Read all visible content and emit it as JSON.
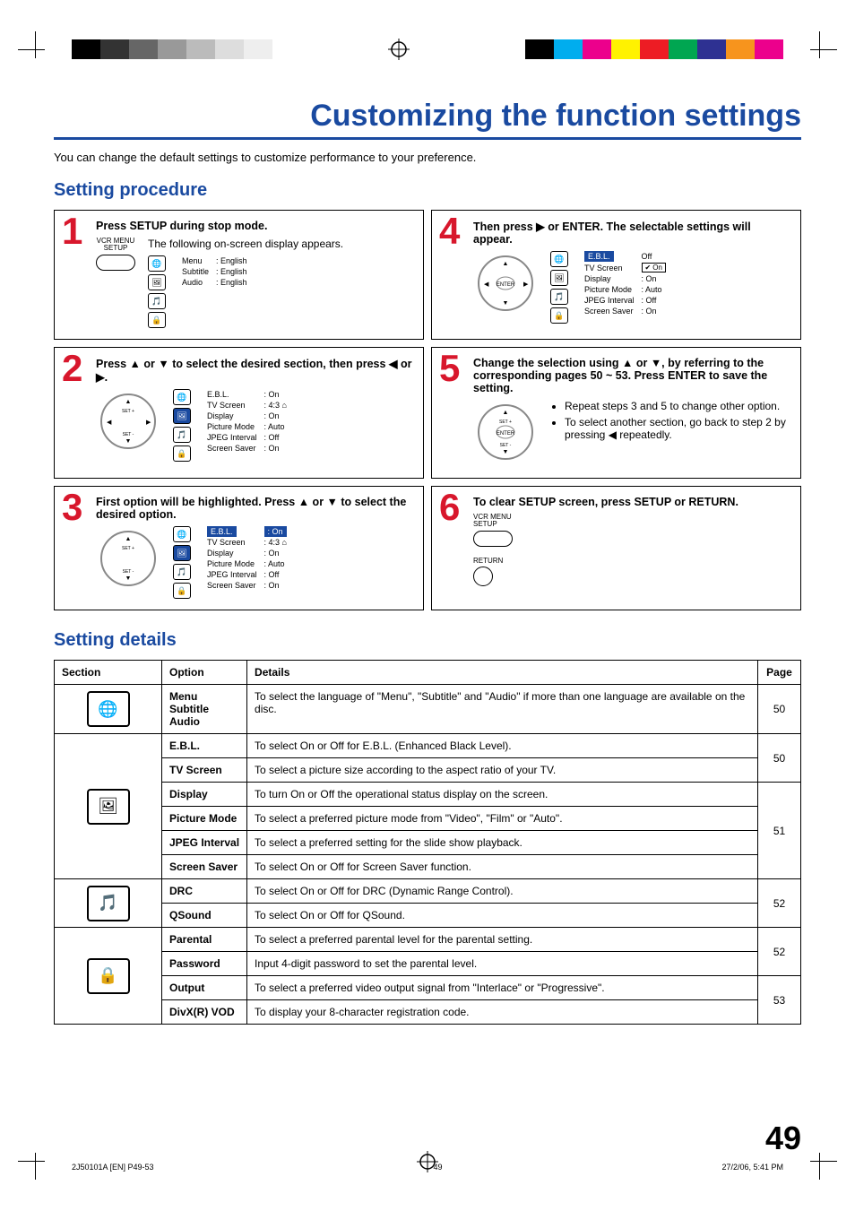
{
  "title": "Customizing the function settings",
  "intro": "You can change the default settings to customize performance to your preference.",
  "headings": {
    "procedure": "Setting procedure",
    "details": "Setting details"
  },
  "steps": {
    "s1": {
      "num": "1",
      "instr": "Press SETUP during stop mode.",
      "btnLabel": "VCR MENU\nSETUP",
      "sub": "The following on-screen display appears.",
      "osd": [
        [
          "Menu",
          ": English"
        ],
        [
          "Subtitle",
          ": English"
        ],
        [
          "Audio",
          ": English"
        ]
      ]
    },
    "s2": {
      "num": "2",
      "instr": "Press ▲ or ▼ to select the desired section, then press ◀ or ▶.",
      "osd": [
        [
          "E.B.L.",
          ": On"
        ],
        [
          "TV Screen",
          ": 4:3 ⌂"
        ],
        [
          "Display",
          ": On"
        ],
        [
          "Picture Mode",
          ": Auto"
        ],
        [
          "JPEG Interval",
          ": Off"
        ],
        [
          "Screen Saver",
          ": On"
        ]
      ]
    },
    "s3": {
      "num": "3",
      "instr": "First option will be highlighted. Press ▲ or ▼ to select the desired option.",
      "osdHighlightLabel": "E.B.L.",
      "osdHighlightValue": ": On",
      "osd": [
        [
          "TV Screen",
          ": 4:3 ⌂"
        ],
        [
          "Display",
          ": On"
        ],
        [
          "Picture Mode",
          ": Auto"
        ],
        [
          "JPEG Interval",
          ": Off"
        ],
        [
          "Screen Saver",
          ": On"
        ]
      ]
    },
    "s4": {
      "num": "4",
      "instr": "Then press ▶ or ENTER. The selectable settings will appear.",
      "osdHighlightLabel": "E.B.L.",
      "osdValueOff": "Off",
      "osdValueOn": "On",
      "osd": [
        [
          "TV Screen",
          ""
        ],
        [
          "Display",
          ": On"
        ],
        [
          "Picture Mode",
          ": Auto"
        ],
        [
          "JPEG Interval",
          ": Off"
        ],
        [
          "Screen Saver",
          ": On"
        ]
      ]
    },
    "s5": {
      "num": "5",
      "instr": "Change the selection using ▲ or ▼, by referring to the corresponding pages 50 ~ 53. Press ENTER to save the setting.",
      "bullets": [
        "Repeat steps 3 and 5 to change other option.",
        "To select another section, go back to step 2 by pressing ◀ repeatedly."
      ]
    },
    "s6": {
      "num": "6",
      "instr": "To clear SETUP screen, press SETUP or RETURN.",
      "btnLabel1": "VCR MENU\nSETUP",
      "btnLabel2": "RETURN"
    }
  },
  "tableHead": {
    "section": "Section",
    "option": "Option",
    "details": "Details",
    "page": "Page"
  },
  "rows": [
    {
      "iconName": "language-icon",
      "option": "Menu\nSubtitle\nAudio",
      "details": "To select the language of \"Menu\", \"Subtitle\" and \"Audio\" if more than one language are available on the disc.",
      "page": "50",
      "rowspan": 1
    },
    {
      "iconName": "picture-icon",
      "option": "E.B.L.",
      "details": "To select On or Off for E.B.L. (Enhanced Black Level).",
      "group": "p50b",
      "page": "50"
    },
    {
      "iconName": "",
      "option": "TV Screen",
      "details": "To select a picture size according to the aspect ratio of your TV.",
      "group": "p50b"
    },
    {
      "iconName": "",
      "option": "Display",
      "details": "To turn On or Off the operational status display on the screen.",
      "group": "p51",
      "page": "51"
    },
    {
      "iconName": "",
      "option": "Picture Mode",
      "details": "To select a preferred picture mode from \"Video\", \"Film\" or \"Auto\".",
      "group": "p51"
    },
    {
      "iconName": "",
      "option": "JPEG Interval",
      "details": "To select a preferred setting for the slide show playback.",
      "group": "p51"
    },
    {
      "iconName": "",
      "option": "Screen Saver",
      "details": "To select On or Off for Screen Saver function.",
      "group": "p51"
    },
    {
      "iconName": "audio-icon",
      "option": "DRC",
      "details": "To select On or Off for DRC (Dynamic Range Control).",
      "group": "p52a",
      "page": "52"
    },
    {
      "iconName": "",
      "option": "QSound",
      "details": "To select On or Off for QSound.",
      "group": "p52a"
    },
    {
      "iconName": "parental-icon",
      "option": "Parental",
      "details": "To select a preferred parental level for the parental setting.",
      "group": "p52b",
      "page": "52"
    },
    {
      "iconName": "",
      "option": "Password",
      "details": "Input 4-digit password to set the parental level.",
      "group": "p52b"
    },
    {
      "iconName": "",
      "option": "Output",
      "details": "To select a preferred video output signal from \"Interlace\" or \"Progressive\".",
      "group": "p53",
      "page": "53"
    },
    {
      "iconName": "",
      "option": "DivX(R) VOD",
      "details": "To display your 8-character registration code.",
      "group": "p53"
    }
  ],
  "pageNum": "49",
  "footer": {
    "left": "2J50101A [EN] P49-53",
    "center": "49",
    "right": "27/2/06, 5:41 PM"
  }
}
